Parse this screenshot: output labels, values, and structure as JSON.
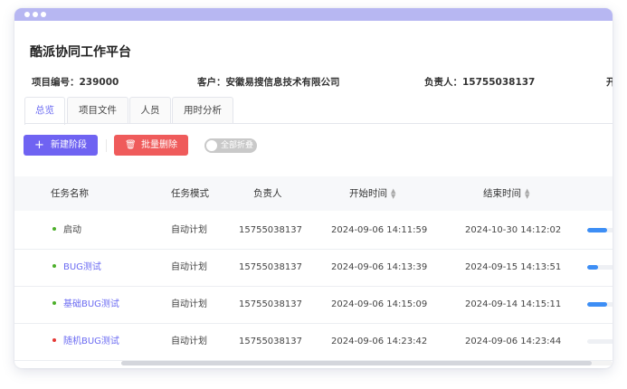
{
  "app": {
    "title": "酷派协同工作平台"
  },
  "project": {
    "number_label": "项目编号：239000",
    "client_label": "客户：安徽易搜信息技术有限公司",
    "owner_label": "负责人：15755038137",
    "overflow_label": "开"
  },
  "tabs": [
    {
      "label": "总览",
      "active": true
    },
    {
      "label": "项目文件",
      "active": false
    },
    {
      "label": "人员",
      "active": false
    },
    {
      "label": "用时分析",
      "active": false
    }
  ],
  "toolbar": {
    "new_icon": "+",
    "new_label": "新建阶段",
    "delete_icon": "🗑",
    "delete_label": "批量删除",
    "collapse_label": "全部折叠",
    "collapse_on": false
  },
  "table": {
    "columns": [
      "任务名称",
      "任务模式",
      "负责人",
      "开始时间",
      "结束时间"
    ],
    "rows": [
      {
        "name": "启动",
        "status_color": "#4caf2a",
        "mode": "自动计划",
        "owner": "15755038137",
        "start": "2024-09-06 14:11:59",
        "end": "2024-10-30 14:12:02",
        "progress": 0.55,
        "link": false
      },
      {
        "name": "BUG测试",
        "status_color": "#4caf2a",
        "mode": "自动计划",
        "owner": "15755038137",
        "start": "2024-09-06 14:13:39",
        "end": "2024-09-15 14:13:51",
        "progress": 0.3,
        "link": true
      },
      {
        "name": "基础BUG测试",
        "status_color": "#4caf2a",
        "mode": "自动计划",
        "owner": "15755038137",
        "start": "2024-09-06 14:15:09",
        "end": "2024-09-14 14:15:11",
        "progress": 0.55,
        "link": true
      },
      {
        "name": "随机BUG测试",
        "status_color": "#e53935",
        "mode": "自动计划",
        "owner": "15755038137",
        "start": "2024-09-06 14:23:42",
        "end": "2024-09-06 14:23:44",
        "progress": 0,
        "link": true
      }
    ]
  },
  "colors": {
    "accent": "#6b6bf2",
    "danger": "#ef5b5b",
    "progress": "#3d8ef5",
    "link": "#6b6bf2"
  }
}
